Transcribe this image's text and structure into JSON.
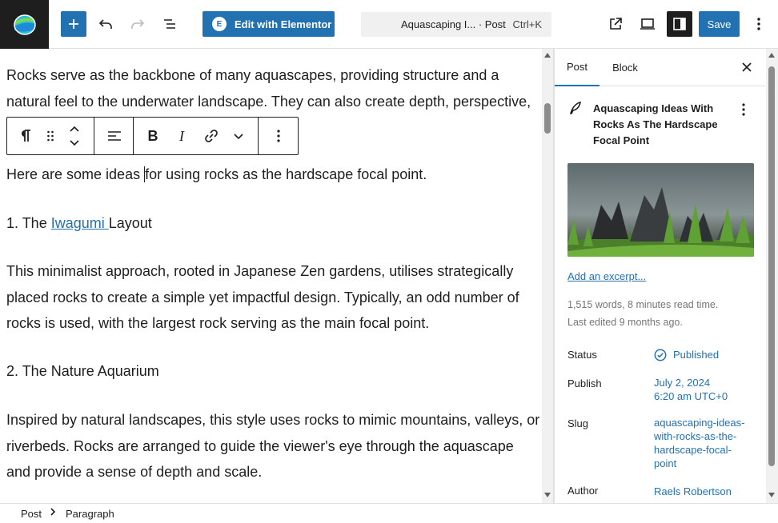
{
  "toolbar": {
    "elementor_label": "Edit with Elementor",
    "elementor_badge": "E",
    "command_title": "Aquascaping I... · Post",
    "command_shortcut": "Ctrl+K",
    "save_label": "Save",
    "accent_color": "#2271b1",
    "icons": [
      "site-logo-icon",
      "plus-icon",
      "undo-icon",
      "redo-icon",
      "document-overview-icon",
      "external-link-icon",
      "preview-desktop-icon",
      "sidebar-settings-icon",
      "more-vertical-icon"
    ]
  },
  "editor": {
    "para1": "Rocks serve as the backbone of many aquascapes, providing structure and a natural feel to the underwater landscape. They can also create depth, perspective,",
    "para2_before": "Here are some ideas ",
    "para2_after": "for using rocks as the hardscape focal point.",
    "heading1_prefix": "1. The ",
    "heading1_link": "Iwagumi ",
    "heading1_suffix": "Layout",
    "para3": "This minimalist approach, rooted in Japanese Zen gardens, utilises strategically placed rocks to create a simple yet impactful design. Typically, an odd number of rocks is used, with the largest rock serving as the main focal point.",
    "heading2": "2. The Nature Aquarium",
    "para4": "Inspired by natural landscapes, this style uses rocks to mimic mountains, valleys, or riverbeds. Rocks are arranged to guide the viewer's eye through the aquascape and provide a sense of depth and scale.",
    "block_toolbar_icons": [
      "paragraph-icon",
      "drag-handle-icon",
      "move-up-down-icon",
      "align-left-icon",
      "bold-icon",
      "italic-icon",
      "link-icon",
      "chevron-down-icon",
      "options-icon"
    ],
    "bold_label": "B",
    "italic_label": "I"
  },
  "sidebar": {
    "tab_post": "Post",
    "tab_block": "Block",
    "post_title": "Aquascaping Ideas With Rocks As The Hardscape Focal Point",
    "excerpt_link": "Add an excerpt...",
    "word_count": "1,515 words, 8 minutes read time.",
    "last_edited": "Last edited 9 months ago.",
    "rows": {
      "status_label": "Status",
      "status_value": "Published",
      "publish_label": "Publish",
      "publish_date": "July 2, 2024",
      "publish_time": "6:20 am UTC+0",
      "slug_label": "Slug",
      "slug_value": "aquascaping-ideas-with-rocks-as-the-hardscape-focal-point",
      "author_label": "Author",
      "author_value": "Raels Robertson"
    }
  },
  "breadcrumb": {
    "item1": "Post",
    "item2": "Paragraph"
  }
}
